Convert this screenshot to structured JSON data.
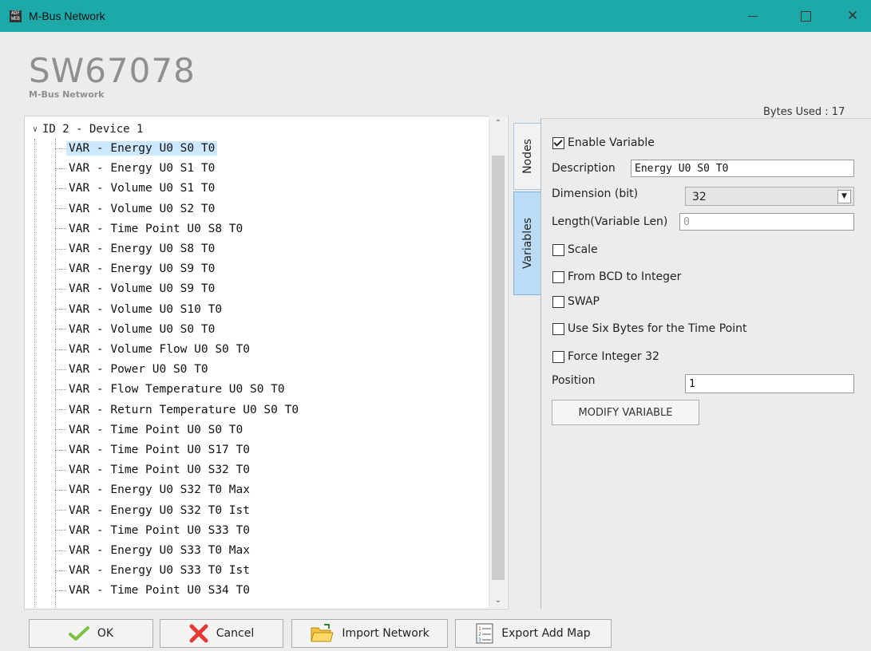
{
  "window": {
    "title": "M-Bus Network",
    "app_icon_text": "ADF\nWEB"
  },
  "header": {
    "product": "SW67078",
    "subtitle": "M-Bus Network",
    "bytes_used": "Bytes Used : 17"
  },
  "tree": {
    "root_label": "ID 2 - Device 1",
    "items": [
      {
        "label": "VAR - Energy U0 S0 T0",
        "selected": true
      },
      {
        "label": "VAR - Energy U0 S1 T0"
      },
      {
        "label": "VAR - Volume U0 S1 T0"
      },
      {
        "label": "VAR - Volume U0 S2 T0"
      },
      {
        "label": "VAR - Time Point U0 S8 T0"
      },
      {
        "label": "VAR - Energy U0 S8 T0"
      },
      {
        "label": "VAR - Energy U0 S9 T0"
      },
      {
        "label": "VAR - Volume U0 S9 T0"
      },
      {
        "label": "VAR - Volume U0 S10 T0"
      },
      {
        "label": "VAR - Volume U0 S0 T0"
      },
      {
        "label": "VAR - Volume Flow U0 S0 T0"
      },
      {
        "label": "VAR - Power U0 S0 T0"
      },
      {
        "label": "VAR - Flow Temperature U0 S0 T0"
      },
      {
        "label": "VAR - Return Temperature U0 S0 T0"
      },
      {
        "label": "VAR - Time Point U0 S0 T0"
      },
      {
        "label": "VAR - Time Point U0 S17 T0"
      },
      {
        "label": "VAR - Time Point U0 S32 T0"
      },
      {
        "label": "VAR - Energy U0 S32 T0 Max"
      },
      {
        "label": "VAR - Energy U0 S32 T0 Ist"
      },
      {
        "label": "VAR - Time Point U0 S33 T0"
      },
      {
        "label": "VAR - Energy U0 S33 T0 Max"
      },
      {
        "label": "VAR - Energy U0 S33 T0 Ist"
      },
      {
        "label": "VAR - Time Point U0 S34 T0"
      }
    ]
  },
  "tabs": {
    "nodes": "Nodes",
    "variables": "Variables"
  },
  "props": {
    "enable_variable_label": "Enable Variable",
    "enable_variable_checked": true,
    "description_label": "Description",
    "description_value": "Energy U0 S0 T0",
    "dimension_label": "Dimension (bit)",
    "dimension_value": "32",
    "length_label": "Length(Variable Len)",
    "length_value": "0",
    "scale_label": "Scale",
    "bcd_label": "From BCD to Integer",
    "swap_label": "SWAP",
    "six_bytes_label": "Use Six Bytes for the Time Point",
    "force_int_label": "Force Integer 32",
    "position_label": "Position",
    "position_value": "1",
    "modify_button": "MODIFY VARIABLE"
  },
  "buttons": {
    "ok": "OK",
    "cancel": "Cancel",
    "import": "Import Network",
    "export": "Export Add Map"
  },
  "colors": {
    "titlebar": "#1ea9a9",
    "selection": "#cce8ff",
    "ok_icon": "#7cc242",
    "cancel_icon": "#e53935",
    "folder_icon": "#f5c342"
  }
}
